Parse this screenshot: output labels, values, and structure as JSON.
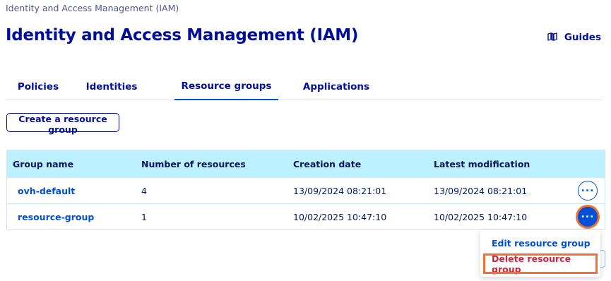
{
  "breadcrumb": "Identity and Access Management (IAM)",
  "page_title": "Identity and Access Management (IAM)",
  "guides_label": "Guides",
  "tabs": [
    {
      "label": "Policies",
      "active": false
    },
    {
      "label": "Identities",
      "active": false
    },
    {
      "label": "Resource groups",
      "active": true
    },
    {
      "label": "Applications",
      "active": false
    }
  ],
  "create_button_label": "Create a resource group",
  "table": {
    "columns": [
      "Group name",
      "Number of resources",
      "Creation date",
      "Latest modification"
    ],
    "rows": [
      {
        "name": "ovh-default",
        "resources": "4",
        "created": "13/09/2024 08:21:01",
        "modified": "13/09/2024 08:21:01"
      },
      {
        "name": "resource-group",
        "resources": "1",
        "created": "10/02/2025 10:47:10",
        "modified": "10/02/2025 10:47:10"
      }
    ],
    "row_action_label": "..."
  },
  "action_menu": {
    "items": [
      "Edit resource group",
      "Delete resource group"
    ]
  },
  "colors": {
    "primary": "#000e9c",
    "link": "#0050d7",
    "header_bg": "#bef1ff",
    "danger": "#d3243c",
    "highlight": "#f07136"
  }
}
